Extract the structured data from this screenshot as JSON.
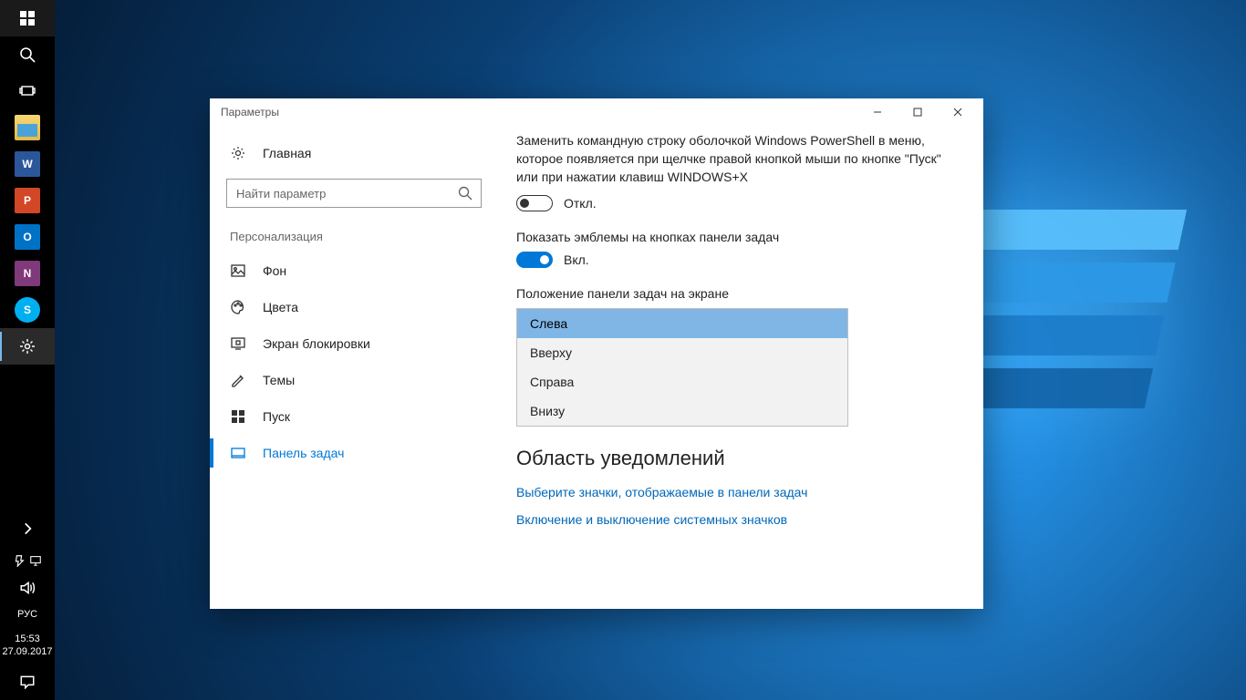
{
  "taskbar": {
    "apps": [
      {
        "name": "start-button",
        "glyph": "win"
      },
      {
        "name": "search-button",
        "glyph": "search"
      },
      {
        "name": "taskview-button",
        "glyph": "taskview"
      },
      {
        "name": "explorer-button",
        "glyph": "explorer"
      },
      {
        "name": "word-button",
        "glyph": "word",
        "label": "W"
      },
      {
        "name": "powerpoint-button",
        "glyph": "ppt",
        "label": "P"
      },
      {
        "name": "outlook-button",
        "glyph": "outlook",
        "label": "O"
      },
      {
        "name": "onenote-button",
        "glyph": "onenote",
        "label": "N"
      },
      {
        "name": "skype-button",
        "glyph": "skype",
        "label": "S"
      },
      {
        "name": "settings-button",
        "glyph": "gear",
        "active": true
      }
    ],
    "tray": {
      "overflow": "overflow",
      "power": "power",
      "network": "network",
      "volume": "volume",
      "lang": "РУС",
      "time": "15:53",
      "date": "27.09.2017",
      "action_center": "action"
    }
  },
  "window": {
    "title": "Параметры",
    "sidebar": {
      "home": "Главная",
      "search_placeholder": "Найти параметр",
      "section": "Персонализация",
      "items": [
        {
          "icon": "picture",
          "label": "Фон"
        },
        {
          "icon": "palette",
          "label": "Цвета"
        },
        {
          "icon": "lockscreen",
          "label": "Экран блокировки"
        },
        {
          "icon": "themes",
          "label": "Темы"
        },
        {
          "icon": "start",
          "label": "Пуск"
        },
        {
          "icon": "taskbar",
          "label": "Панель задач"
        }
      ],
      "active_index": 5
    },
    "content": {
      "powershell_desc": "Заменить командную строку оболочкой Windows PowerShell в меню, которое появляется при щелчке правой кнопкой мыши по кнопке \"Пуск\" или при нажатии клавиш WINDOWS+X",
      "off_label": "Откл.",
      "badges_label": "Показать эмблемы на кнопках панели задач",
      "on_label": "Вкл.",
      "position_label": "Положение панели задач на экране",
      "position_options": [
        "Слева",
        "Вверху",
        "Справа",
        "Внизу"
      ],
      "position_selected": 0,
      "notif_area_heading": "Область уведомлений",
      "link_icons": "Выберите значки, отображаемые в панели задач",
      "link_system_icons": "Включение и выключение системных значков"
    }
  }
}
